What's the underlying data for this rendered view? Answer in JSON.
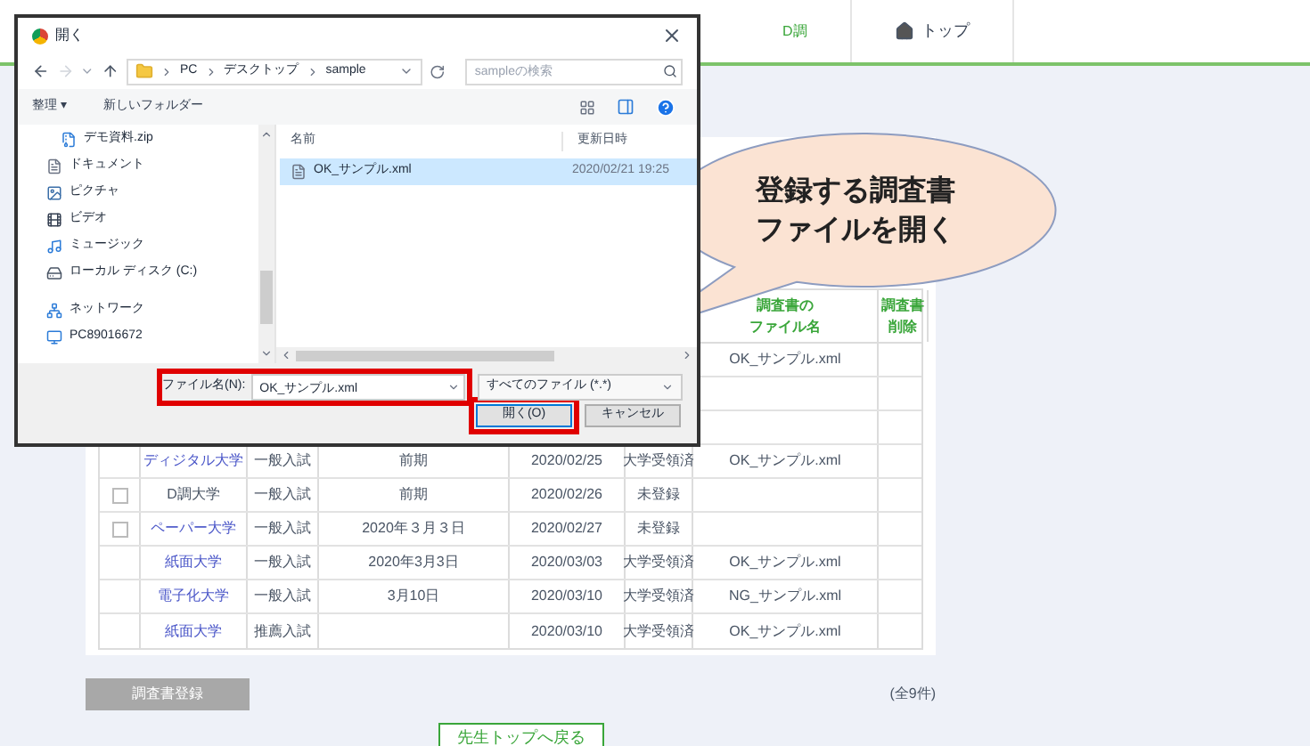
{
  "header": {
    "nav": [
      {
        "kind": "text",
        "label": "D調"
      },
      {
        "kind": "home",
        "label": "トップ"
      }
    ]
  },
  "table": {
    "columns": [
      {
        "lines": [
          "調査書の",
          "ファイル名"
        ]
      },
      {
        "lines": [
          "調査書",
          "削除"
        ]
      }
    ],
    "rows": [
      {
        "kind": "plain",
        "file": "OK_サンプル.xml"
      },
      {
        "kind": "plain"
      },
      {
        "kind": "plain"
      },
      {
        "kind": "plain",
        "link": true,
        "university": "ディジタル大学",
        "exam": "一般入試",
        "term": "前期",
        "date": "2020/02/25",
        "status": "大学受領済",
        "file": "OK_サンプル.xml"
      },
      {
        "kind": "checkable",
        "checked": false,
        "link": false,
        "university": "D調大学",
        "exam": "一般入試",
        "term": "前期",
        "date": "2020/02/26",
        "status": "未登録"
      },
      {
        "kind": "checkable",
        "checked": false,
        "link": true,
        "university": "ペーパー大学",
        "exam": "一般入試",
        "term": "2020年３月３日",
        "date": "2020/02/27",
        "status": "未登録"
      },
      {
        "kind": "plain",
        "link": true,
        "university": "紙面大学",
        "exam": "一般入試",
        "term": "2020年3月3日",
        "date": "2020/03/03",
        "status": "大学受領済",
        "file": "OK_サンプル.xml"
      },
      {
        "kind": "plain",
        "link": true,
        "university": "電子化大学",
        "exam": "一般入試",
        "term": "3月10日",
        "date": "2020/03/10",
        "status": "大学受領済",
        "file": "NG_サンプル.xml"
      },
      {
        "kind": "plain",
        "link": true,
        "university": "紙面大学",
        "exam": "推薦入試",
        "date": "2020/03/10",
        "status": "大学受領済",
        "file": "OK_サンプル.xml"
      }
    ]
  },
  "register_button": {
    "label": "調査書登録",
    "disabled": true
  },
  "count": "(全9件)",
  "back_button": "先生トップへ戻る",
  "callout": [
    "登録する調査書",
    "ファイルを開く"
  ],
  "dialog": {
    "title": "開く",
    "path": [
      "PC",
      "デスクトップ",
      "sample"
    ],
    "search": {
      "placeholder": "sampleの検索"
    },
    "toolbar": [
      "整理 ▾",
      "新しいフォルダー"
    ],
    "nav": [
      {
        "kind": "zip",
        "label": "デモ資料.zip"
      },
      {
        "kind": "doc",
        "label": "ドキュメント"
      },
      {
        "kind": "pic",
        "label": "ピクチャ"
      },
      {
        "kind": "video",
        "label": "ビデオ"
      },
      {
        "kind": "music",
        "label": "ミュージック"
      },
      {
        "kind": "disk",
        "label": "ローカル ディスク (C:)"
      },
      {
        "kind": "network",
        "label": "ネットワーク"
      },
      {
        "kind": "pc",
        "label": "PC89016672"
      }
    ],
    "columns": [
      "名前",
      "更新日時"
    ],
    "files": [
      {
        "name": "OK_サンプル.xml",
        "modified": "2020/02/21 19:25",
        "selected": true
      }
    ],
    "filename_label": "ファイル名(N):",
    "filename": "OK_サンプル.xml",
    "filter": "すべてのファイル (*.*)",
    "open_button": "開く(O)",
    "cancel_button": "キャンセル"
  }
}
